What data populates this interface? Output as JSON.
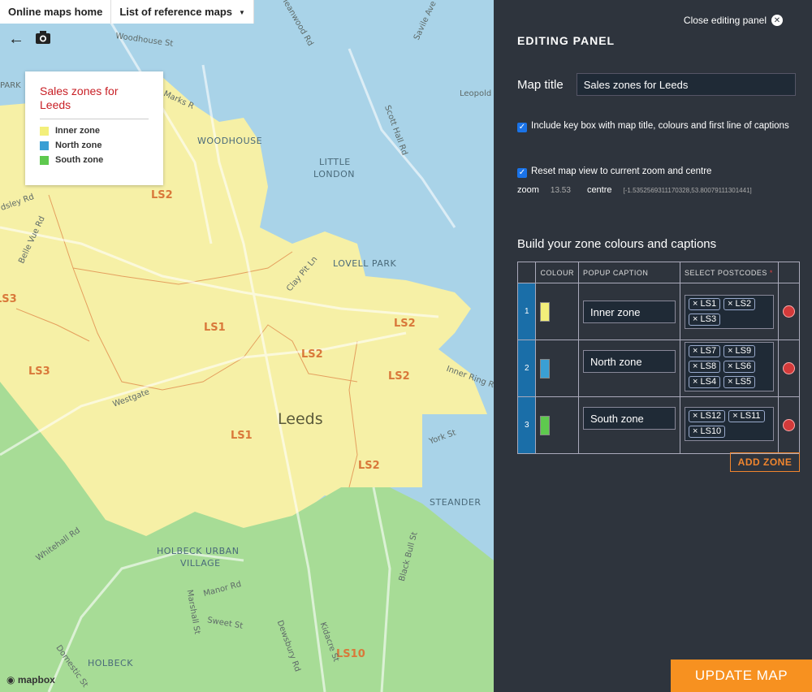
{
  "nav": {
    "home_label": "Online maps home",
    "reference_label": "List of reference maps",
    "caret_icon": "caret-down-icon"
  },
  "tools": {
    "back_icon": "arrow-left-icon",
    "camera_icon": "camera-icon"
  },
  "keybox": {
    "title": "Sales zones for Leeds",
    "items": [
      {
        "label": "Inner zone",
        "color": "#f3ef7a"
      },
      {
        "label": "North zone",
        "color": "#3a9fd4"
      },
      {
        "label": "South zone",
        "color": "#5ec94e"
      }
    ]
  },
  "map": {
    "city_label": "Leeds",
    "area_labels": [
      "WOODHOUSE",
      "LITTLE",
      "LONDON",
      "LOVELL PARK",
      "STEANDER",
      "HOLBECK URBAN",
      "VILLAGE",
      "HOLBECK"
    ],
    "postcode_labels": [
      "LS2",
      "LS1",
      "LS2",
      "LS3",
      "LS2",
      "LS2",
      "LS1",
      "LS2",
      "LS3",
      "LS10"
    ],
    "streets": [
      "Woodhouse St",
      "Meanwood Rd",
      "Savile Ave",
      "Marks R",
      "Scott Hall Rd",
      "Leopold S",
      "Belle Vue Rd",
      "Clay Pit Ln",
      "Westgate",
      "Inner Ring Ro",
      "York St",
      "Whitehall Rd",
      "Manor Rd",
      "Marshall St",
      "Sweet St",
      "Black Bull St",
      "Dewsbury Rd",
      "Kidacre St",
      "Domestic St",
      "dsley Rd",
      "PARK"
    ],
    "attribution": "mapbox"
  },
  "panel": {
    "close_label": "Close editing panel",
    "title": "EDITING PANEL",
    "map_title_label": "Map title",
    "map_title_value": "Sales zones for Leeds",
    "include_key_label": "Include key box with map title, colours and first line of captions",
    "reset_view_label": "Reset map view to current zoom and centre",
    "zoom_label": "zoom",
    "zoom_value": "13.53",
    "centre_label": "centre",
    "centre_value": "[-1.5352569311170328,53.80079111301441]",
    "build_title": "Build your zone colours and captions",
    "columns": [
      "COLOUR",
      "POPUP CAPTION",
      "SELECT POSTCODES"
    ],
    "required_mark": "*",
    "zones": [
      {
        "num": "1",
        "color": "#f3ef7a",
        "caption": "Inner zone",
        "postcodes": [
          "LS1",
          "LS2",
          "LS3"
        ]
      },
      {
        "num": "2",
        "color": "#3a9fd4",
        "caption": "North zone",
        "postcodes": [
          "LS7",
          "LS9",
          "LS8",
          "LS6",
          "LS4",
          "LS5"
        ]
      },
      {
        "num": "3",
        "color": "#5ec94e",
        "caption": "South zone",
        "postcodes": [
          "LS12",
          "LS11",
          "LS10"
        ]
      }
    ],
    "add_zone_label": "ADD ZONE",
    "update_map_label": "UPDATE MAP"
  }
}
